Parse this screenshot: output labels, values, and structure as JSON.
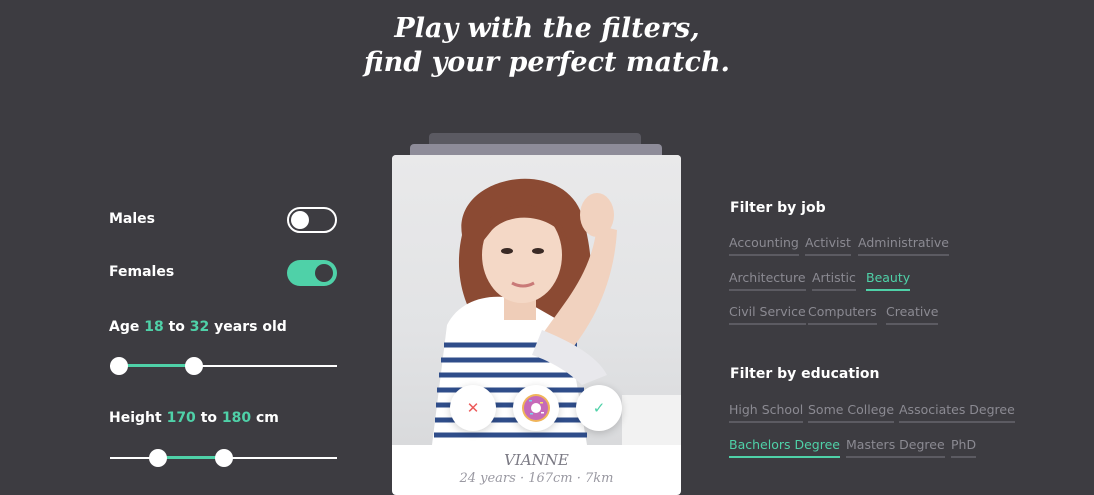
{
  "headline": {
    "line1": "Play with the filters,",
    "line2": "find your perfect match."
  },
  "gender_filters": [
    {
      "label": "Males",
      "on": false
    },
    {
      "label": "Females",
      "on": true
    }
  ],
  "age": {
    "prefix": "Age",
    "min": "18",
    "connector": "to",
    "max": "32",
    "suffix": "years old",
    "min_fraction": 0.04,
    "max_fraction": 0.37
  },
  "height": {
    "prefix": "Height",
    "min": "170",
    "connector": "to",
    "max": "180",
    "suffix": "cm",
    "min_fraction": 0.21,
    "max_fraction": 0.5
  },
  "profile": {
    "name": "VIANNE",
    "meta": "24 years · 167cm · 7km"
  },
  "card_actions": {
    "reject_icon": "close-icon",
    "super_icon": "donut-icon",
    "accept_icon": "check-icon"
  },
  "job_filter": {
    "title": "Filter by job",
    "tags": [
      {
        "label": "Accounting",
        "active": false
      },
      {
        "label": "Activist",
        "active": false
      },
      {
        "label": "Administrative",
        "active": false
      },
      {
        "label": "Architecture",
        "active": false
      },
      {
        "label": "Artistic",
        "active": false
      },
      {
        "label": "Beauty",
        "active": true
      },
      {
        "label": "Civil Service",
        "active": false
      },
      {
        "label": "Computers",
        "active": false
      },
      {
        "label": "Creative",
        "active": false
      }
    ]
  },
  "education_filter": {
    "title": "Filter by education",
    "tags": [
      {
        "label": "High School",
        "active": false
      },
      {
        "label": "Some College",
        "active": false
      },
      {
        "label": "Associates Degree",
        "active": false
      },
      {
        "label": "Bachelors Degree",
        "active": true
      },
      {
        "label": "Masters Degree",
        "active": false
      },
      {
        "label": "PhD",
        "active": false
      }
    ]
  },
  "colors": {
    "background": "#3d3c41",
    "accent": "#4fd1a8",
    "reject": "#ec5a5a"
  }
}
